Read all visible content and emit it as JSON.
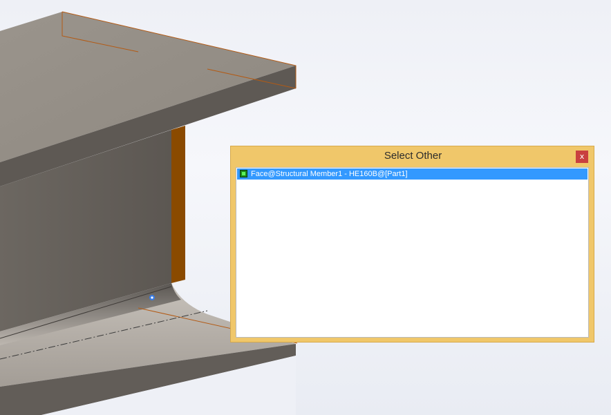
{
  "dialog": {
    "title": "Select Other",
    "close_label": "x",
    "items": [
      {
        "label": "Face@Structural Member1 - HE160B@[Part1]",
        "icon": "face-icon",
        "selected": true
      }
    ]
  },
  "colors": {
    "dialog_background": "#f0c76a",
    "close_button": "#c9403f",
    "selection_highlight": "#3399ff",
    "highlighted_face": "#8a4a00",
    "beam_top_face": "#9b958d",
    "beam_side_face": "#625d58"
  }
}
